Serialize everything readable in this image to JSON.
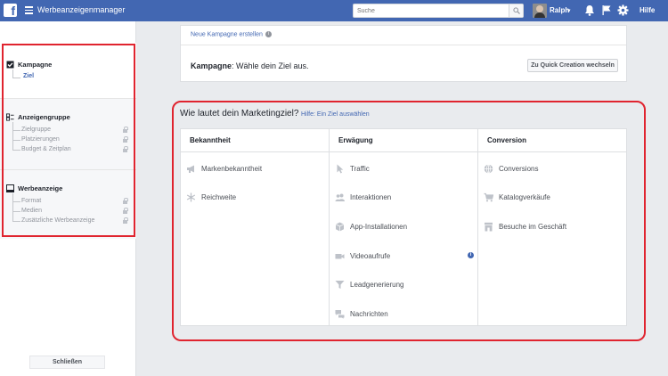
{
  "topbar": {
    "logo": "f",
    "app_title": "Werbeanzeigenmanager",
    "search_placeholder": "Suche",
    "user_name": "Ralph",
    "help_label": "Hilfe"
  },
  "sidebar": {
    "campaign": {
      "title": "Kampagne",
      "items": [
        "Ziel"
      ]
    },
    "adset": {
      "title": "Anzeigengruppe",
      "items": [
        "Zielgruppe",
        "Platzierungen",
        "Budget & Zeitplan"
      ]
    },
    "ad": {
      "title": "Werbeanzeige",
      "items": [
        "Format",
        "Medien",
        "Zusätzliche Werbeanzeige"
      ]
    },
    "close_label": "Schließen"
  },
  "campaign_card": {
    "new_campaign_link": "Neue Kampagne erstellen",
    "label_bold": "Kampagne",
    "label_rest": ": Wähle dein Ziel aus.",
    "quick_creation_button": "Zu Quick Creation wechseln"
  },
  "marketing": {
    "title": "Wie lautet dein Marketingziel?",
    "help_link": "Hilfe: Ein Ziel auswählen",
    "columns": [
      {
        "title": "Bekanntheit",
        "items": [
          "Markenbekanntheit",
          "Reichweite"
        ]
      },
      {
        "title": "Erwägung",
        "items": [
          "Traffic",
          "Interaktionen",
          "App-Installationen",
          "Videoaufrufe",
          "Leadgenerierung",
          "Nachrichten"
        ]
      },
      {
        "title": "Conversion",
        "items": [
          "Conversions",
          "Katalogverkäufe",
          "Besuche im Geschäft"
        ]
      }
    ]
  },
  "colors": {
    "brand": "#4267b2",
    "highlight": "#e0242f",
    "icon_grey": "#bec2c9"
  },
  "icons": {
    "bekanntheit": [
      "megaphone-icon",
      "snowflake-icon"
    ],
    "erwaegung": [
      "cursor-icon",
      "people-icon",
      "box-icon",
      "video-camera-icon",
      "funnel-icon",
      "chat-bubbles-icon"
    ],
    "conversion": [
      "globe-icon",
      "cart-icon",
      "store-icon"
    ]
  }
}
